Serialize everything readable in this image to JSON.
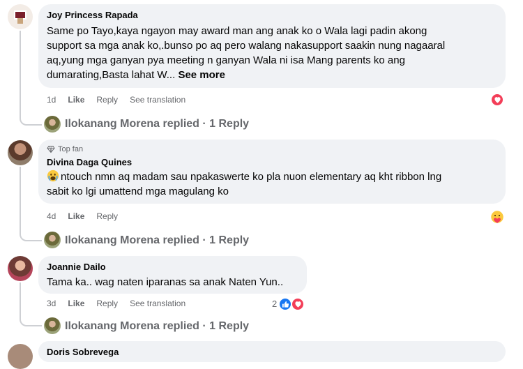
{
  "comments": [
    {
      "author": "Joy Princess Rapada",
      "text_lines": [
        "Same po Tayo,kaya ngayon may award man ang anak ko o Wala lagi padin akong",
        "support sa mga anak ko,.bunso po aq pero walang nakasupport saakin nung nagaaral",
        "aq,yung mga ganyan pya meeting n ganyan Wala ni isa Mang parents ko ang",
        "dumarating,Basta lahat W..."
      ],
      "see_more": "See more",
      "time": "1d",
      "like": "Like",
      "reply": "Reply",
      "translate": "See translation",
      "reaction_icon": "love-reaction-icon",
      "replied_by": "Ilokanang Morena replied · 1 Reply"
    },
    {
      "badge": "Top fan",
      "author": "Divina Daga Quines",
      "text_lines": [
        "ntouch nmn aq madam sau npakaswerte ko pla nuon elementary aq kht ribbon lng",
        "sabit ko lgi umattend mga magulang ko"
      ],
      "lead_emoji": "crying-face-emoji",
      "time": "4d",
      "like": "Like",
      "reply": "Reply",
      "reaction_icon": "care-reaction-icon",
      "replied_by": "Ilokanang Morena replied · 1 Reply"
    },
    {
      "author": "Joannie Dailo",
      "text_lines": [
        "Tama ka.. wag naten iparanas sa anak Naten Yun.."
      ],
      "time": "3d",
      "like": "Like",
      "reply": "Reply",
      "translate": "See translation",
      "reaction_count": "2",
      "replied_by": "Ilokanang Morena replied · 1 Reply"
    },
    {
      "author": "Doris Sobrevega"
    }
  ],
  "colors": {
    "bubble": "#f0f2f5",
    "secondary_text": "#65676b",
    "love": "#f33e58",
    "like": "#1877f2"
  }
}
